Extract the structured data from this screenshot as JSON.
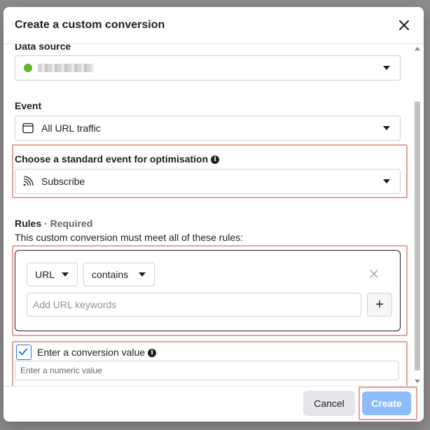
{
  "dialog": {
    "title": "Create a custom conversion"
  },
  "data_source": {
    "label": "Data source",
    "status_color": "#5fb52e"
  },
  "event": {
    "label": "Event",
    "value": "All URL traffic"
  },
  "standard_event": {
    "label": "Choose a standard event for optimisation",
    "value": "Subscribe"
  },
  "rules": {
    "label": "Rules",
    "required": " · Required",
    "description": "This custom conversion must meet all of these rules:",
    "field": "URL",
    "operator": "contains",
    "keyword_placeholder": "Add URL keywords",
    "add_label": "+"
  },
  "conversion_value": {
    "checked": true,
    "label": "Enter a conversion value",
    "placeholder": "Enter a numeric value"
  },
  "footer": {
    "cancel_label": "Cancel",
    "create_label": "Create"
  },
  "colors": {
    "accent": "#1877f2",
    "highlight": "#e8a198",
    "create_disabled": "#8cbcfb"
  }
}
